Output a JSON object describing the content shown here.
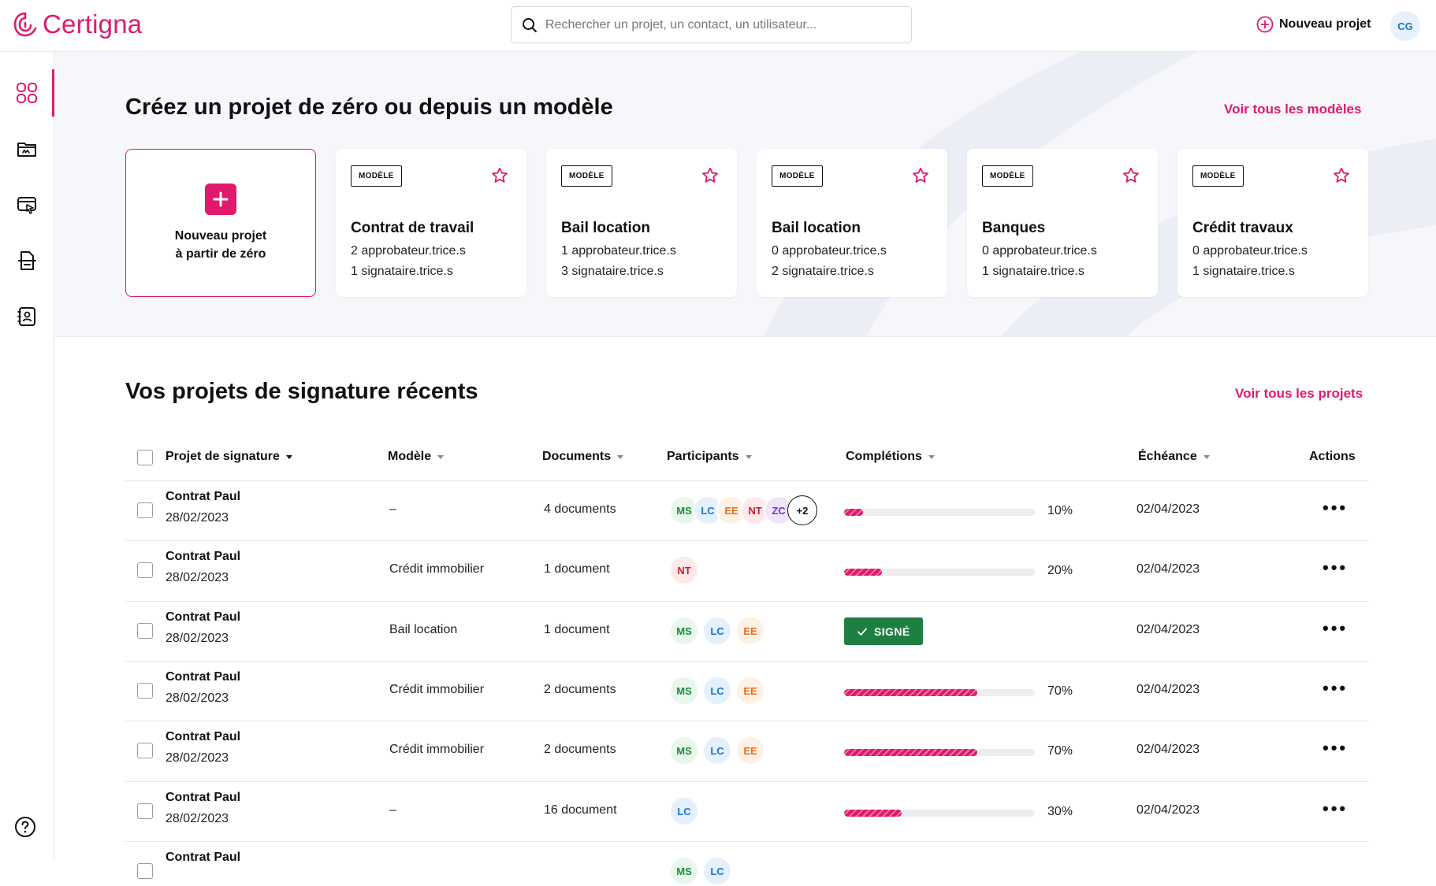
{
  "app": {
    "name": "Certigna"
  },
  "search": {
    "placeholder": "Rechercher un projet, un contact, un utilisateur..."
  },
  "header": {
    "new_project_label": "Nouveau projet",
    "user_initials": "CG"
  },
  "sidebar": {
    "items": [
      {
        "icon": "dashboard-grid-icon",
        "active": true
      },
      {
        "icon": "folder-signature-icon",
        "active": false
      },
      {
        "icon": "screen-cursor-icon",
        "active": false
      },
      {
        "icon": "document-archive-icon",
        "active": false
      },
      {
        "icon": "contacts-icon",
        "active": false
      }
    ],
    "help_icon": "help-icon"
  },
  "templates": {
    "title": "Créez un projet de zéro ou depuis un modèle",
    "see_all": "Voir tous les modèles",
    "new_card": {
      "line1": "Nouveau projet",
      "line2": "à partir de zéro"
    },
    "badge": "MODÈLE",
    "items": [
      {
        "title": "Contrat de travail",
        "approvers": "2 approbateur.trice.s",
        "signers": "1  signataire.trice.s"
      },
      {
        "title": "Bail location",
        "approvers": "1  approbateur.trice.s",
        "signers": "3 signataire.trice.s"
      },
      {
        "title": "Bail location",
        "approvers": "0 approbateur.trice.s",
        "signers": "2 signataire.trice.s"
      },
      {
        "title": "Banques",
        "approvers": "0 approbateur.trice.s",
        "signers": "1  signataire.trice.s"
      },
      {
        "title": "Crédit travaux",
        "approvers": "0 approbateur.trice.s",
        "signers": "1  signataire.trice.s"
      }
    ]
  },
  "projects": {
    "title": "Vos projets de signature récents",
    "see_all": "Voir tous les projets",
    "columns": {
      "project": "Projet de signature",
      "model": "Modèle",
      "documents": "Documents",
      "participants": "Participants",
      "completions": "Complétions",
      "due": "Échéance",
      "actions": "Actions"
    },
    "rows": [
      {
        "name": "Contrat Paul",
        "date": "28/02/2023",
        "model": "–",
        "documents": "4 documents",
        "participants": [
          "MS",
          "LC",
          "EE",
          "NT",
          "ZC"
        ],
        "more": "+2",
        "progress": 10,
        "progress_label": "10%",
        "signed": false,
        "due": "02/04/2023"
      },
      {
        "name": "Contrat Paul",
        "date": "28/02/2023",
        "model": "Crédit immobilier",
        "documents": "1 document",
        "participants": [
          "NT"
        ],
        "more": "",
        "progress": 20,
        "progress_label": "20%",
        "signed": false,
        "due": "02/04/2023"
      },
      {
        "name": "Contrat Paul",
        "date": "28/02/2023",
        "model": "Bail location",
        "documents": "1 document",
        "participants": [
          "MS",
          "LC",
          "EE"
        ],
        "more": "",
        "progress": 100,
        "progress_label": "",
        "signed": true,
        "signed_label": "SIGNÉ",
        "due": "02/04/2023"
      },
      {
        "name": "Contrat Paul",
        "date": "28/02/2023",
        "model": "Crédit immobilier",
        "documents": "2 documents",
        "participants": [
          "MS",
          "LC",
          "EE"
        ],
        "more": "",
        "progress": 70,
        "progress_label": "70%",
        "signed": false,
        "due": "02/04/2023"
      },
      {
        "name": "Contrat Paul",
        "date": "28/02/2023",
        "model": "Crédit immobilier",
        "documents": "2 documents",
        "participants": [
          "MS",
          "LC",
          "EE"
        ],
        "more": "",
        "progress": 70,
        "progress_label": "70%",
        "signed": false,
        "due": "02/04/2023"
      },
      {
        "name": "Contrat Paul",
        "date": "28/02/2023",
        "model": "–",
        "documents": "16 document",
        "participants": [
          "LC"
        ],
        "more": "",
        "progress": 30,
        "progress_label": "30%",
        "signed": false,
        "due": "02/04/2023"
      },
      {
        "name": "Contrat Paul",
        "date": "",
        "model": "",
        "documents": "",
        "participants": [
          "MS",
          "LC"
        ],
        "more": "",
        "progress": 0,
        "progress_label": "",
        "signed": false,
        "due": "",
        "partial": true
      }
    ]
  },
  "colors": {
    "accent": "#e0196d",
    "signed": "#1e7f43"
  }
}
